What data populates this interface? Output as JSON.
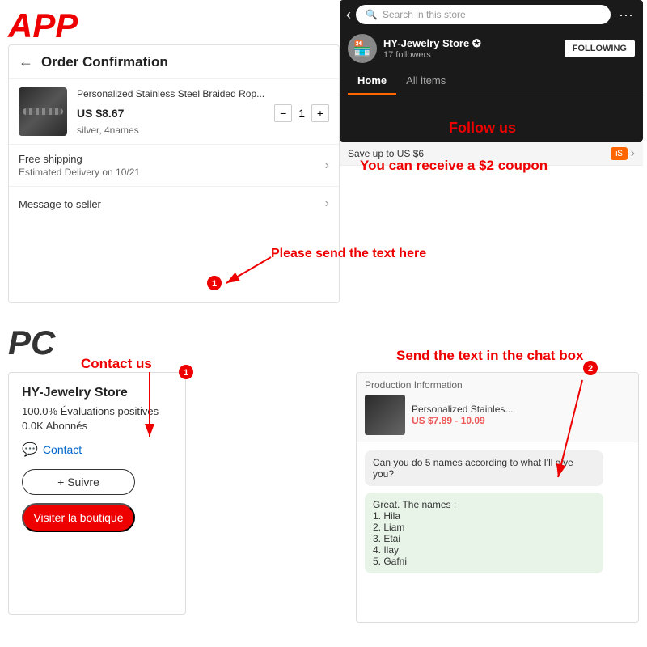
{
  "labels": {
    "app": "APP",
    "pc": "PC"
  },
  "order": {
    "title": "Order Confirmation",
    "product_name": "Personalized Stainless Steel Braided Rop...",
    "price": "US $8.67",
    "quantity": "1",
    "variant": "silver,  4names",
    "shipping_title": "Free shipping",
    "shipping_delivery": "Estimated Delivery on 10/21",
    "message_label": "Message to seller"
  },
  "store_app": {
    "search_placeholder": "Search in this store",
    "store_name": "HY-Jewelry Store",
    "verified": "✪",
    "followers": "17 followers",
    "following_btn": "FOLLOWING",
    "nav_home": "Home",
    "nav_all": "All items",
    "banner_save": "Save up to US $6",
    "coupon_badge": "i$"
  },
  "annotations": {
    "follow_us": "Follow us",
    "coupon": "You can receive a $2 coupon",
    "send_text": "Please send the text here",
    "contact_us": "Contact us",
    "chat_box": "Send the text in the chat box"
  },
  "pc_store": {
    "name": "HY-Jewelry Store",
    "rating": "100.0% Évaluations positives",
    "subscribers": "0.0K Abonnés",
    "contact": "Contact",
    "follow_btn": "+ Suivre",
    "visit_btn": "Visiter la boutique"
  },
  "pc_chat": {
    "production_info": "Production Information",
    "product_name": "Personalized Stainles...",
    "product_price": "US $7.89 - 10.09",
    "user_message": "Can you do 5 names according to what I'll give you?",
    "seller_reply": "Great. The names :\n1. Hila\n2. Liam\n3. Etai\n4. Ilay\n5. Gafni"
  }
}
